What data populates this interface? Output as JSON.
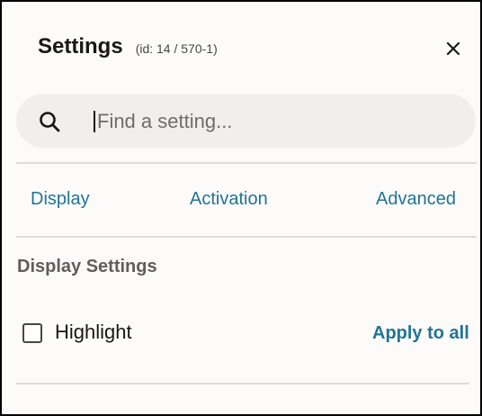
{
  "header": {
    "title": "Settings",
    "subtitle": "(id: 14 / 570-1)",
    "close_icon": "close-icon"
  },
  "search": {
    "icon": "search-icon",
    "value": "",
    "placeholder": "Find a setting..."
  },
  "tabs": [
    {
      "label": "Display"
    },
    {
      "label": "Activation"
    },
    {
      "label": "Advanced"
    }
  ],
  "section": {
    "title": "Display Settings",
    "options": [
      {
        "label": "Highlight",
        "checked": false,
        "action_label": "Apply to all"
      }
    ]
  },
  "colors": {
    "accent": "#227494",
    "panel_background": "#fcfbfa",
    "search_background": "#f1efed",
    "divider": "#dedbd8"
  }
}
